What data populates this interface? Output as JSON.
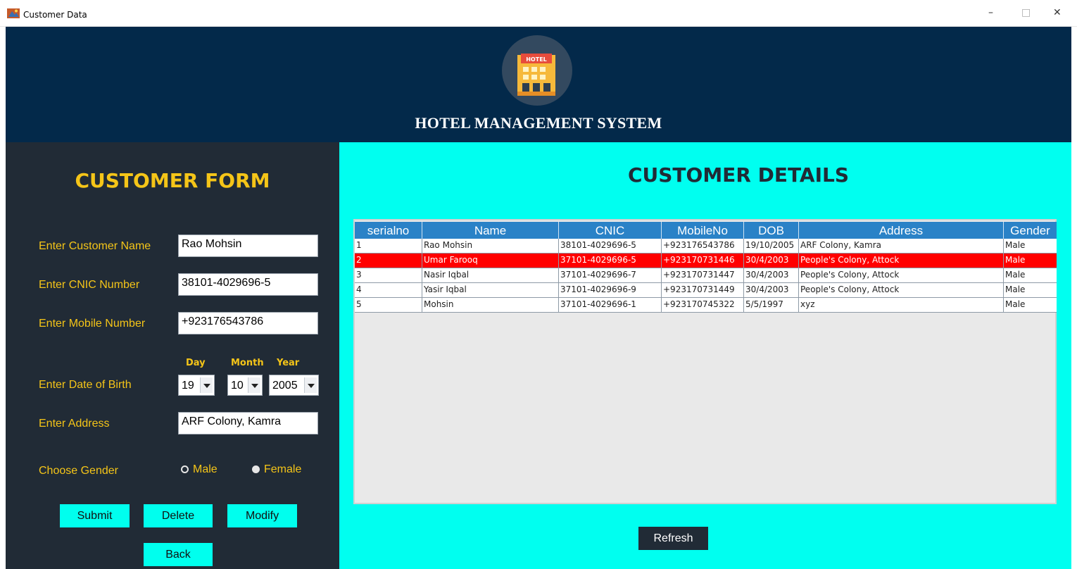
{
  "window": {
    "title": "Customer Data",
    "minimize": "–",
    "maximize": "□",
    "close": "✕"
  },
  "header": {
    "logo_text": "HOTEL",
    "brand": "HOTEL MANAGEMENT SYSTEM"
  },
  "form": {
    "title": "CUSTOMER FORM",
    "name_label": "Enter Customer Name",
    "name_value": "Rao Mohsin",
    "cnic_label": "Enter CNIC Number",
    "cnic_value": "38101-4029696-5",
    "mobile_label": "Enter Mobile Number",
    "mobile_value": "+923176543786",
    "dob_label": "Enter Date of Birth",
    "day_label": "Day",
    "month_label": "Month",
    "year_label": "Year",
    "day_value": "19",
    "month_value": "10",
    "year_value": "2005",
    "address_label": "Enter Address",
    "address_value": "ARF Colony, Kamra",
    "gender_label": "Choose Gender",
    "male_label": "Male",
    "female_label": "Female",
    "gender_selected": "Male",
    "submit": "Submit",
    "delete": "Delete",
    "modify": "Modify",
    "back": "Back"
  },
  "details": {
    "title": "CUSTOMER DETAILS",
    "columns": [
      "serialno",
      "Name",
      "CNIC",
      "MobileNo",
      "DOB",
      "Address",
      "Gender"
    ],
    "rows": [
      [
        "1",
        "Rao Mohsin",
        "38101-4029696-5",
        "+923176543786",
        "19/10/2005",
        "ARF Colony, Kamra",
        "Male"
      ],
      [
        "2",
        "Umar Farooq",
        "37101-4029696-5",
        "+923170731446",
        "30/4/2003",
        "People's Colony, Attock",
        "Male"
      ],
      [
        "3",
        "Nasir Iqbal",
        "37101-4029696-7",
        "+923170731447",
        "30/4/2003",
        "People's Colony, Attock",
        "Male"
      ],
      [
        "4",
        "Yasir Iqbal",
        "37101-4029696-9",
        "+923170731449",
        "30/4/2003",
        "People's Colony, Attock",
        "Male"
      ],
      [
        "5",
        "Mohsin",
        "37101-4029696-1",
        "+923170745322",
        "5/5/1997",
        "xyz",
        "Male"
      ]
    ],
    "selected_row": 2,
    "refresh": "Refresh"
  },
  "colors": {
    "header_bg": "#03294a",
    "panel_bg": "#212b36",
    "accent_yellow": "#f5c518",
    "cyan": "#00fff0",
    "table_header": "#2a82c7",
    "selected_row": "#ff0000"
  }
}
